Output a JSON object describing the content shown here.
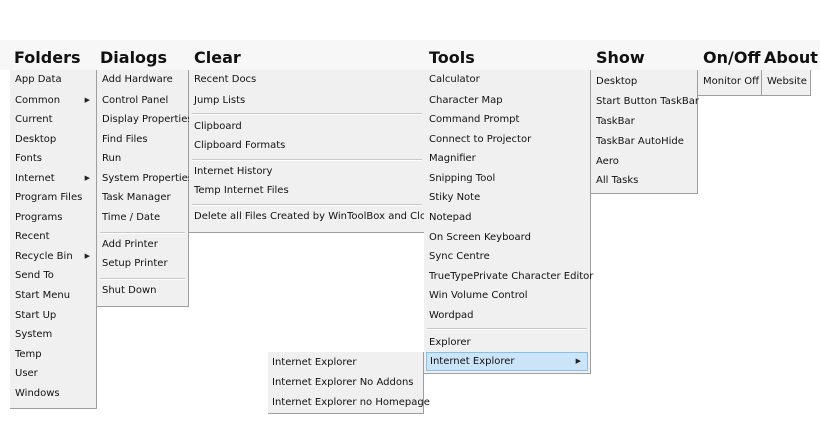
{
  "headers": {
    "folders": "Folders",
    "dialogs": "Dialogs",
    "clear": "Clear",
    "tools": "Tools",
    "show": "Show",
    "onoff": "On/Off",
    "about": "About"
  },
  "folders": [
    "App Data",
    "Common",
    "Current",
    "Desktop",
    "Fonts",
    "Internet",
    "Program Files",
    "Programs",
    "Recent",
    "Recycle Bin",
    "Send To",
    "Start Menu",
    "Start Up",
    "System",
    "Temp",
    "User",
    "Windows"
  ],
  "dialogs": [
    "Add Hardware",
    "Control Panel",
    "Display Properties",
    "Find Files",
    "Run",
    "System Properties",
    "Task Manager",
    "Time / Date",
    "Add Printer",
    "Setup Printer",
    "Shut Down"
  ],
  "clear": [
    "Recent Docs",
    "Jump Lists",
    "Clipboard",
    "Clipboard Formats",
    "Internet History",
    "Temp Internet Files",
    "Delete all Files Created by WinToolBox and Close"
  ],
  "tools": [
    "Calculator",
    "Character Map",
    "Command Prompt",
    "Connect to Projector",
    "Magnifier",
    "Snipping Tool",
    "Stiky Note",
    "Notepad",
    "On Screen Keyboard",
    "Sync Centre",
    "TrueTypePrivate Character Editor",
    "Win Volume Control",
    "Wordpad",
    "Explorer",
    "Internet Explorer"
  ],
  "show": [
    "Desktop",
    "Start Button  TaskBar",
    "TaskBar",
    "TaskBar AutoHide",
    "Aero",
    "All Tasks"
  ],
  "onoff": [
    "Monitor Off"
  ],
  "about": [
    "Website"
  ],
  "submenu": [
    "Internet Explorer",
    "Internet Explorer No Addons",
    "Internet Explorer no Homepage"
  ],
  "arrow_glyph": "▶",
  "highlight_color": "#cce4f7"
}
